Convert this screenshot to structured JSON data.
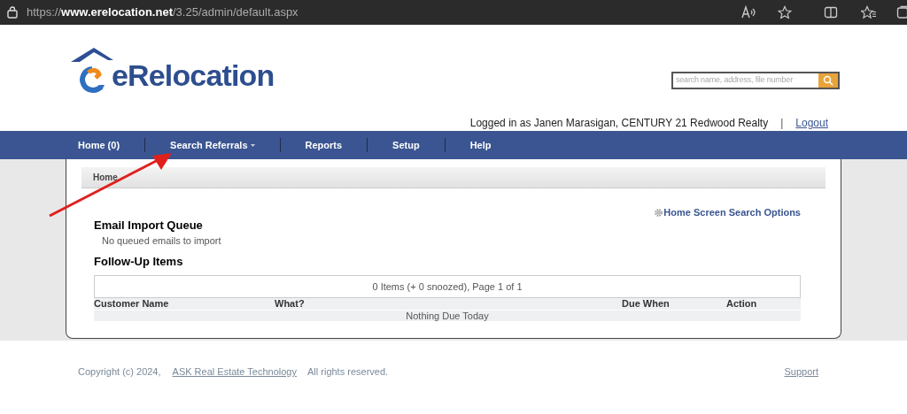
{
  "browser": {
    "url_scheme": "https://",
    "url_host": "www.erelocation.net",
    "url_path": "/3.25/admin/default.aspx"
  },
  "header": {
    "logo_text": "eRelocation",
    "search": {
      "placeholder": "search name, address, file number"
    },
    "login_text": "Logged in as Janen Marasigan, CENTURY 21 Redwood Realty",
    "separator": "|",
    "logout": "Logout"
  },
  "nav": [
    {
      "label": "Home (0)",
      "dropdown": false
    },
    {
      "label": "Search Referrals",
      "dropdown": true
    },
    {
      "label": "Reports",
      "dropdown": false
    },
    {
      "label": "Setup",
      "dropdown": false
    },
    {
      "label": "Help",
      "dropdown": false
    }
  ],
  "breadcrumb": "Home",
  "search_options_link": "Home Screen Search Options",
  "email_queue": {
    "title": "Email Import Queue",
    "message": "No queued emails to import"
  },
  "follow_up": {
    "title": "Follow-Up Items",
    "pager": "0 Items (+ 0 snoozed), Page 1 of 1",
    "columns": [
      "Customer Name",
      "What?",
      "Due When",
      "Action"
    ],
    "empty": "Nothing Due Today"
  },
  "footer": {
    "copyright": "Copyright (c) 2024,",
    "company_link": "ASK Real Estate Technology",
    "rights": "All rights reserved.",
    "support": "Support"
  }
}
